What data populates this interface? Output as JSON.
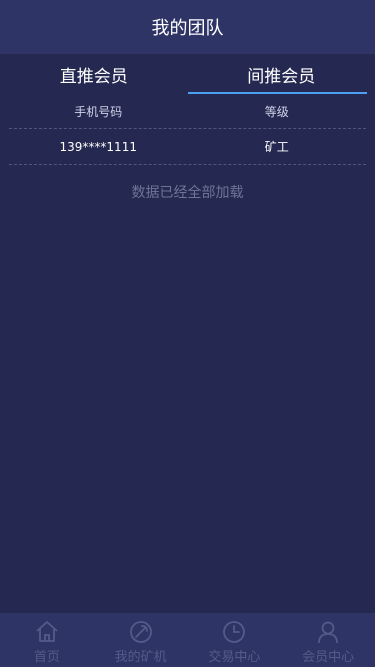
{
  "header": {
    "title": "我的团队"
  },
  "tabs": [
    {
      "label": "直推会员",
      "active": false
    },
    {
      "label": "间推会员",
      "active": true
    }
  ],
  "table": {
    "columns": [
      "手机号码",
      "等级"
    ],
    "rows": [
      [
        "139****1111",
        "矿工"
      ]
    ]
  },
  "status_text": "数据已经全部加载",
  "bottom_nav": [
    {
      "label": "首页",
      "icon": "home-icon"
    },
    {
      "label": "我的矿机",
      "icon": "miner-icon"
    },
    {
      "label": "交易中心",
      "icon": "clock-icon"
    },
    {
      "label": "会员中心",
      "icon": "user-icon"
    }
  ],
  "colors": {
    "background": "#252850",
    "header": "#2f3466",
    "accent": "#4d9ff2",
    "nav_inactive": "#545b8a"
  }
}
